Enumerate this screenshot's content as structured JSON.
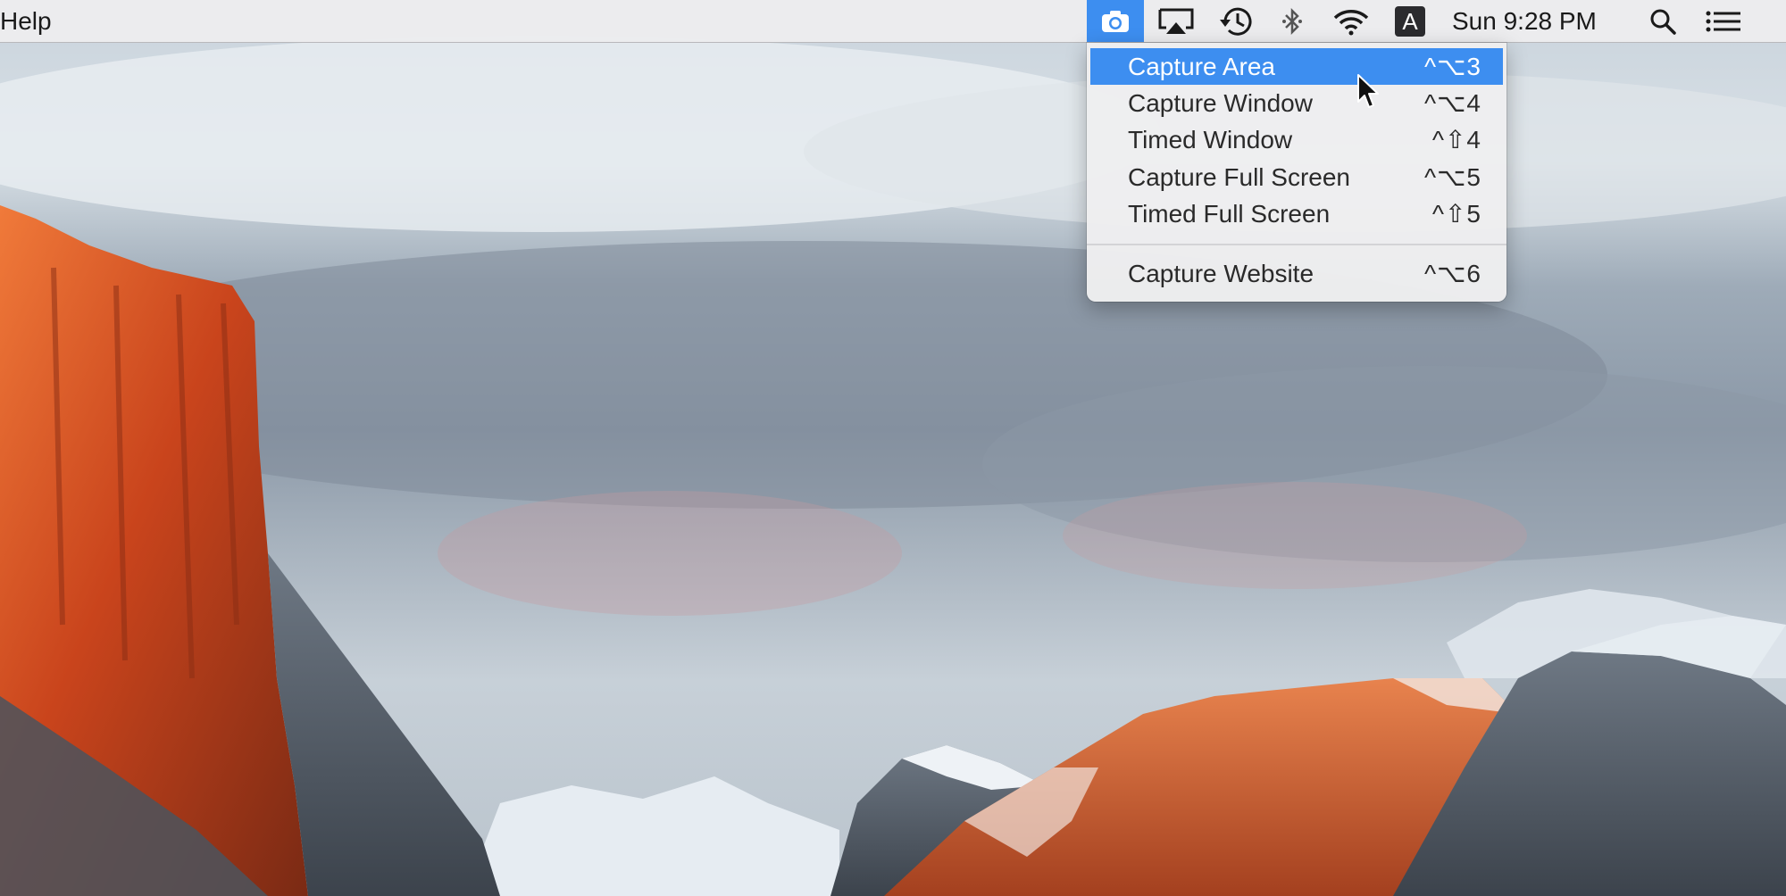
{
  "menubar": {
    "app_menu": "Help",
    "clock": "Sun 9:28 PM",
    "status_icons": [
      "camera-icon",
      "airplay-icon",
      "time-machine-icon",
      "bluetooth-icon",
      "wifi-icon",
      "input-source-icon",
      "spotlight-icon",
      "notification-center-icon"
    ],
    "input_source_letter": "A"
  },
  "capture_menu": {
    "items": [
      {
        "label": "Capture Area",
        "shortcut": "^⌥3",
        "highlighted": true
      },
      {
        "label": "Capture Window",
        "shortcut": "^⌥4"
      },
      {
        "label": "Timed Window",
        "shortcut": "^⇧4"
      },
      {
        "label": "Capture Full Screen",
        "shortcut": "^⌥5"
      },
      {
        "label": "Timed Full Screen",
        "shortcut": "^⇧5"
      },
      {
        "label": "Capture Website",
        "shortcut": "^⌥6"
      }
    ]
  },
  "colors": {
    "highlight": "#3d8ef0",
    "menubar_bg": "#ececee"
  }
}
